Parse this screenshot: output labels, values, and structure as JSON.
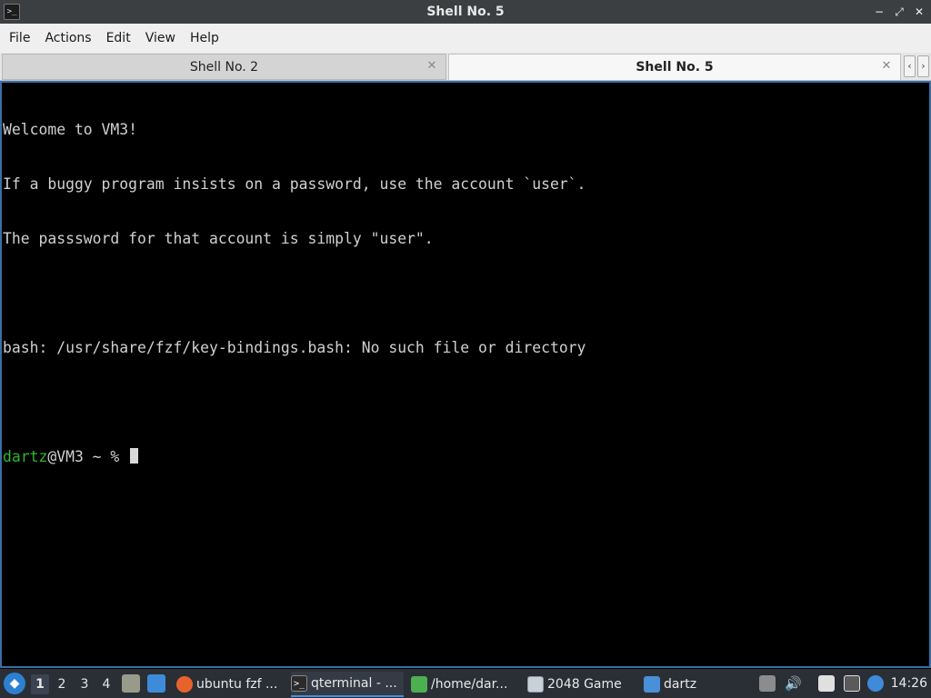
{
  "window": {
    "title": "Shell No. 5",
    "app_icon": "terminal-icon"
  },
  "menu": {
    "items": [
      "File",
      "Actions",
      "Edit",
      "View",
      "Help"
    ]
  },
  "tabs": [
    {
      "label": "Shell No. 2",
      "active": false
    },
    {
      "label": "Shell No. 5",
      "active": true
    }
  ],
  "terminal": {
    "lines": [
      "Welcome to VM3!",
      "If a buggy program insists on a password, use the account `user`.",
      "The passsword for that account is simply \"user\".",
      "",
      "bash: /usr/share/fzf/key-bindings.bash: No such file or directory",
      ""
    ],
    "prompt_user": "dartz",
    "prompt_rest": "@VM3 ~ % "
  },
  "taskbar": {
    "desktops": [
      "1",
      "2",
      "3",
      "4"
    ],
    "active_desktop": "1",
    "tasks": [
      {
        "label": "ubuntu fzf ...",
        "icon": "firefox-icon",
        "color": "#e8632b"
      },
      {
        "label": "qterminal - ...",
        "icon": "terminal-icon",
        "color": "#2b2b2b"
      },
      {
        "label": "/home/dar...",
        "icon": "text-editor-icon",
        "color": "#4caf50"
      },
      {
        "label": "2048 Game",
        "icon": "window-icon",
        "color": "#9aa7b5"
      },
      {
        "label": "dartz",
        "icon": "folder-icon",
        "color": "#4a90d9"
      }
    ],
    "clock": "14:26"
  }
}
